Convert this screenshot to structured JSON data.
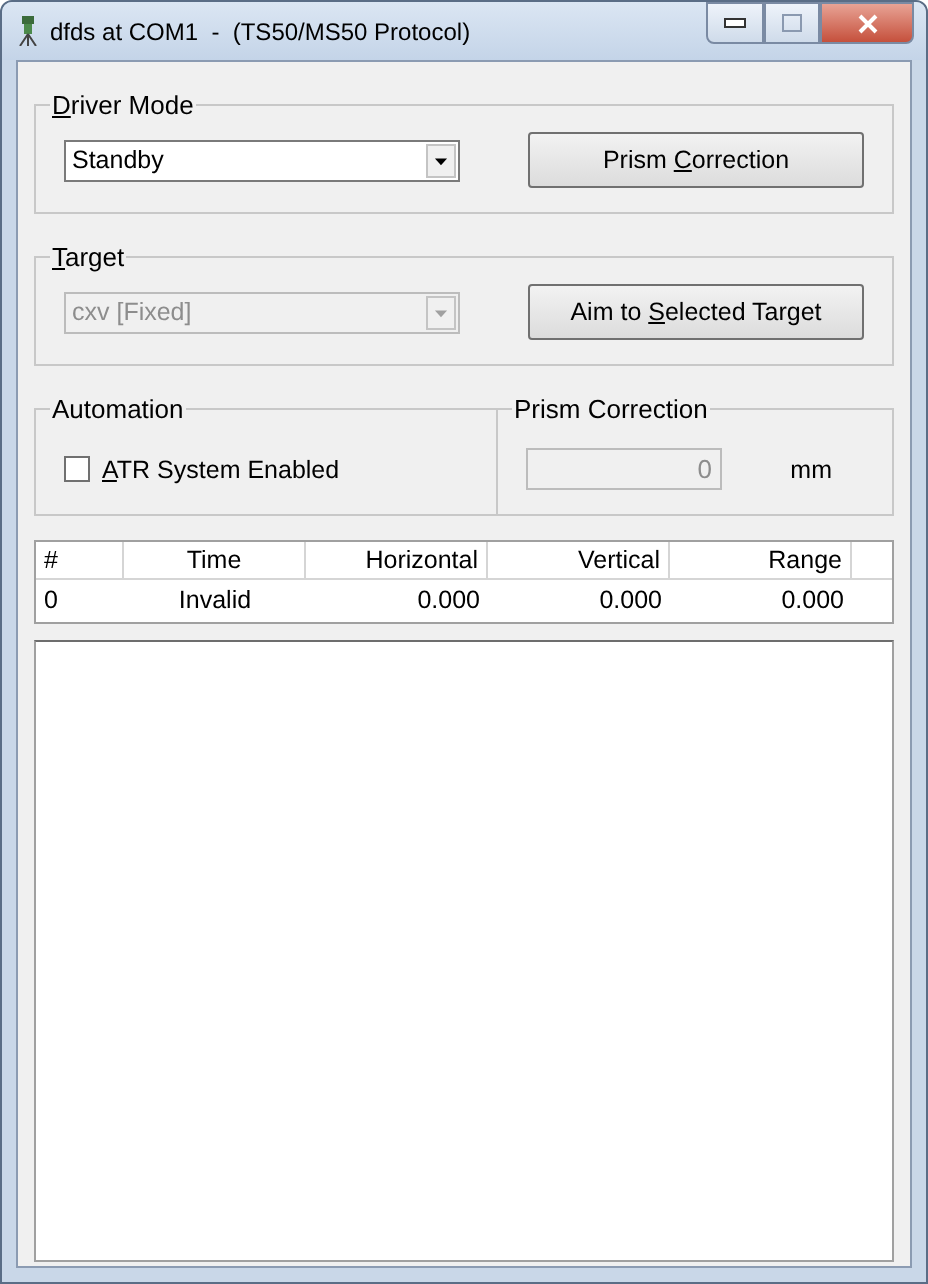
{
  "window": {
    "title": "dfds at COM1  -  (TS50/MS50 Protocol)"
  },
  "driver_mode": {
    "label": {
      "underlined": "D",
      "after": "river Mode"
    },
    "value": "Standby",
    "disabled": false,
    "button": {
      "before": "Prism ",
      "underlined": "C",
      "after": "orrection"
    }
  },
  "target": {
    "label": {
      "underlined": "T",
      "after": "arget"
    },
    "value": "cxv [Fixed]",
    "disabled": true,
    "button": {
      "before": "Aim to ",
      "underlined": "S",
      "after": "elected Target"
    }
  },
  "automation": {
    "label": "Automation",
    "checkbox": {
      "underlined": "A",
      "after": "TR System Enabled"
    },
    "checked": false
  },
  "prism_correction": {
    "label": "Prism Correction",
    "value": "0",
    "disabled": true,
    "unit": "mm"
  },
  "table": {
    "columns": [
      "#",
      "Time",
      "Horizontal",
      "Vertical",
      "Range"
    ],
    "rows": [
      [
        "0",
        "Invalid",
        "0.000",
        "0.000",
        "0.000"
      ]
    ]
  }
}
